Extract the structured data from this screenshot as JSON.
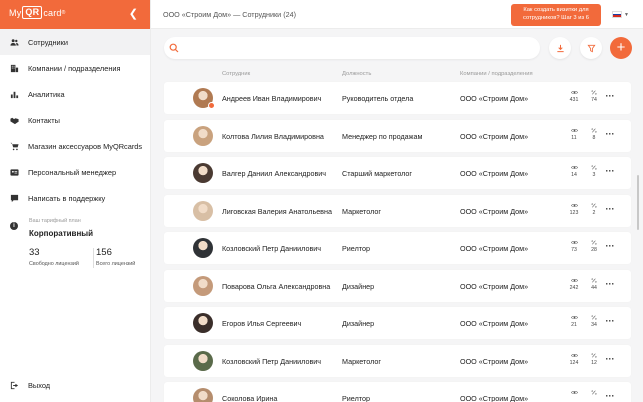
{
  "brand": {
    "name_prefix": "My",
    "name_qr": "QR",
    "name_suffix": "card",
    "reg": "®"
  },
  "sidebar": {
    "items": [
      {
        "label": "Сотрудники",
        "icon": "users-icon",
        "active": true
      },
      {
        "label": "Компании / подразделения",
        "icon": "building-icon"
      },
      {
        "label": "Аналитика",
        "icon": "chart-icon"
      },
      {
        "label": "Контакты",
        "icon": "handshake-icon"
      },
      {
        "label": "Магазин аксессуаров MyQRcards",
        "icon": "cart-icon"
      },
      {
        "label": "Персональный менеджер",
        "icon": "id-card-icon"
      },
      {
        "label": "Написать в поддержку",
        "icon": "chat-icon"
      }
    ],
    "plan": {
      "label": "Ваш тарифный план",
      "name": "Корпоративный",
      "free_count": "33",
      "free_label": "Свободно лицензий",
      "total_count": "156",
      "total_label": "Всего лицензий"
    },
    "logout_label": "Выход"
  },
  "topbar": {
    "title": "ООО «Строим Дом» — Сотрудники (24)",
    "hint": "Как создать визитки для сотрудников? Шаг 3 из 6",
    "language": "RU"
  },
  "search": {
    "placeholder": "",
    "value": ""
  },
  "table": {
    "columns": {
      "employee": "Сотрудник",
      "position": "Должность",
      "company": "Компании / подразделения"
    },
    "rows": [
      {
        "name": "Андреев Иван Владимирович",
        "position": "Руководитель отдела",
        "company": "ООО «Строим Дом»",
        "views": "431",
        "clicks": "74",
        "avatar_color": "#b07a52",
        "badge": true
      },
      {
        "name": "Колтова Лилия Владимировна",
        "position": "Менеджер по продажам",
        "company": "ООО «Строим Дом»",
        "views": "11",
        "clicks": "8",
        "avatar_color": "#c9a27e"
      },
      {
        "name": "Валгер Даниил Александрович",
        "position": "Старший маркетолог",
        "company": "ООО «Строим Дом»",
        "views": "14",
        "clicks": "3",
        "avatar_color": "#4a3a32"
      },
      {
        "name": "Лиговская Валерия Анатольевна",
        "position": "Маркетолог",
        "company": "ООО «Строим Дом»",
        "views": "123",
        "clicks": "2",
        "avatar_color": "#d8bfa5"
      },
      {
        "name": "Козловский Петр Даниилович",
        "position": "Риелтор",
        "company": "ООО «Строим Дом»",
        "views": "73",
        "clicks": "28",
        "avatar_color": "#2f3236"
      },
      {
        "name": "Поварова Ольга Александровна",
        "position": "Дизайнер",
        "company": "ООО «Строим Дом»",
        "views": "242",
        "clicks": "44",
        "avatar_color": "#c49a7a"
      },
      {
        "name": "Егоров Илья Сергеевич",
        "position": "Дизайнер",
        "company": "ООО «Строим Дом»",
        "views": "21",
        "clicks": "34",
        "avatar_color": "#3a2e2a"
      },
      {
        "name": "Козловский Петр Даниилович",
        "position": "Маркетолог",
        "company": "ООО «Строим Дом»",
        "views": "124",
        "clicks": "12",
        "avatar_color": "#5a6a4a"
      },
      {
        "name": "Соколова Ирина",
        "position": "Риелтор",
        "company": "ООО «Строим Дом»",
        "views": "",
        "clicks": "",
        "avatar_color": "#b58d6d"
      }
    ]
  },
  "colors": {
    "accent": "#f26a3b",
    "background": "#f5f5f6"
  }
}
